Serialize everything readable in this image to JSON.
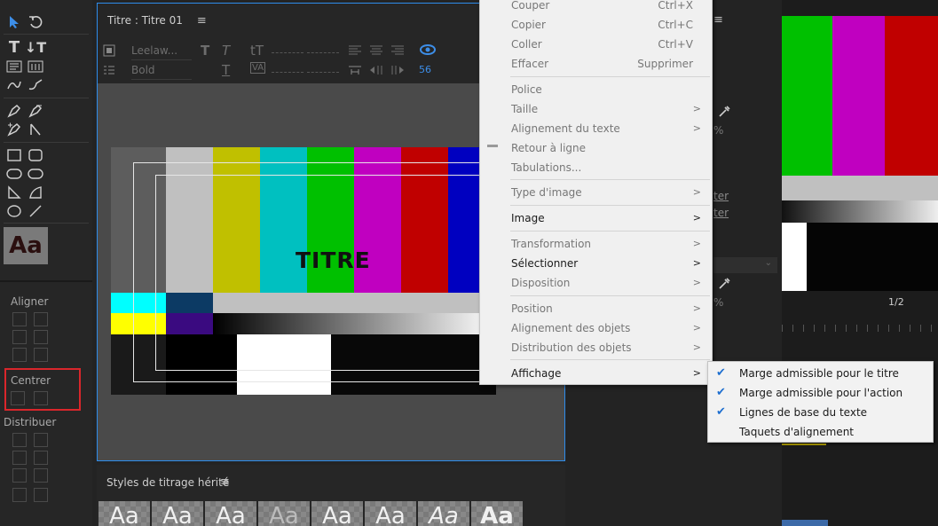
{
  "title_panel": {
    "title": "Titre : Titre 01",
    "menu_icon": "hamburger-icon",
    "font_name": "Leelaw...",
    "font_style": "Bold",
    "kerning_value": "56",
    "canvas_title_text": "TITRE"
  },
  "left_panel": {
    "style_swatch": "Aa",
    "align_label": "Aligner",
    "center_label": "Centrer",
    "distribute_label": "Distribuer"
  },
  "styles_panel": {
    "title": "Styles de titrage hérité",
    "thumbnails": [
      "Aa",
      "Aa",
      "Aa",
      "Aa",
      "Aa",
      "Aa",
      "Aa",
      "Aa"
    ]
  },
  "props_fragments": {
    "pct1": "%",
    "link1": "ter",
    "link2": "ter",
    "pct2": "%"
  },
  "monitor": {
    "page_indicator": "1/2"
  },
  "context_menu": {
    "items": [
      {
        "label": "Couper",
        "shortcut": "Ctrl+X"
      },
      {
        "label": "Copier",
        "shortcut": "Ctrl+C"
      },
      {
        "label": "Coller",
        "shortcut": "Ctrl+V"
      },
      {
        "label": "Effacer",
        "shortcut": "Supprimer"
      },
      {
        "label": "Police"
      },
      {
        "label": "Taille"
      },
      {
        "label": "Alignement du texte"
      },
      {
        "label": "Retour à ligne"
      },
      {
        "label": "Tabulations..."
      },
      {
        "label": "Type d'image"
      },
      {
        "label": "Image"
      },
      {
        "label": "Transformation"
      },
      {
        "label": "Sélectionner"
      },
      {
        "label": "Disposition"
      },
      {
        "label": "Position"
      },
      {
        "label": "Alignement des objets"
      },
      {
        "label": "Distribution des objets"
      },
      {
        "label": "Affichage"
      }
    ],
    "submenu_arrow": ">"
  },
  "submenu": {
    "items": [
      {
        "label": "Marge admissible pour le titre",
        "checked": true
      },
      {
        "label": "Marge admissible pour l'action",
        "checked": true
      },
      {
        "label": "Lignes de base du texte",
        "checked": true
      },
      {
        "label": "Taquets d'alignement",
        "checked": false
      }
    ],
    "check_glyph": "✔"
  },
  "colors": {
    "accent_blue": "#2d8ceb",
    "highlight_red": "#d9262b",
    "check_blue": "#1e6fd0"
  }
}
